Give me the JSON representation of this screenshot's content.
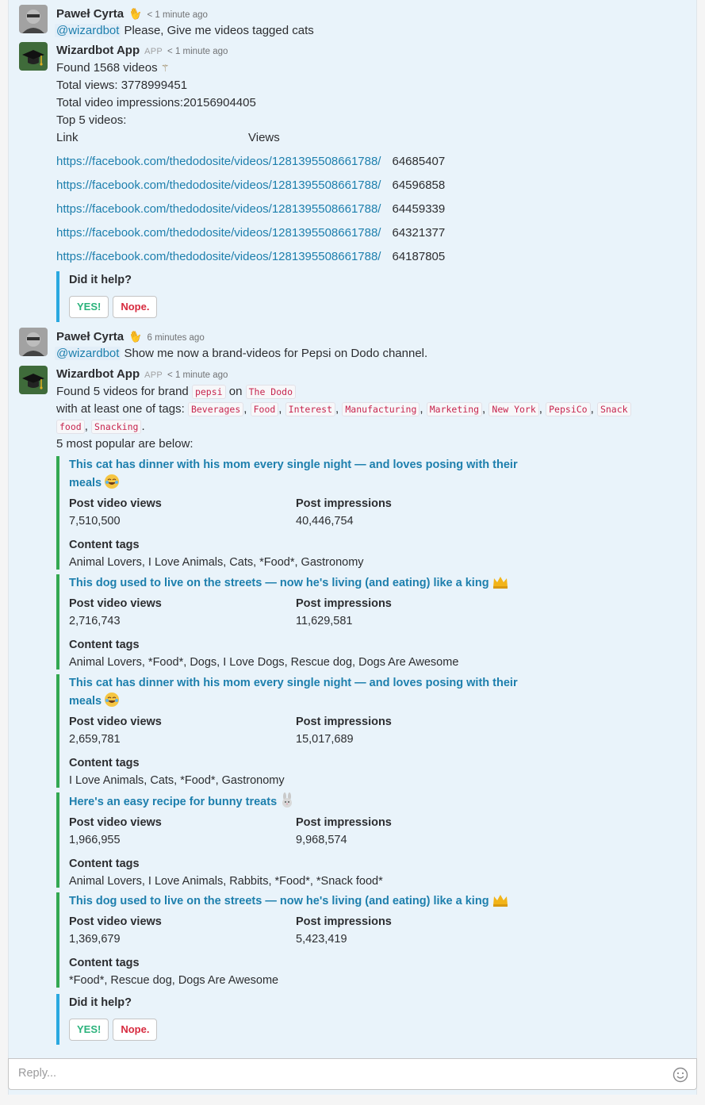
{
  "messages": [
    {
      "author": "Paweł Cyrta",
      "timestamp": "< 1 minute ago",
      "mention": "@wizardbot",
      "text": "Please, Give me videos tagged cats"
    },
    {
      "author": "Wizardbot App",
      "badge": "APP",
      "timestamp": "< 1 minute ago",
      "found": "Found 1568 videos",
      "total_views": "Total views: 3778999451",
      "total_impressions": "Total video impressions:20156904405",
      "top5": "Top 5 videos:",
      "table_headers": [
        "Link",
        "Views"
      ],
      "rows": [
        {
          "link": "https://facebook.com/thedodosite/videos/1281395508661788/",
          "views": "64685407"
        },
        {
          "link": "https://facebook.com/thedodosite/videos/1281395508661788/",
          "views": "64596858"
        },
        {
          "link": "https://facebook.com/thedodosite/videos/1281395508661788/",
          "views": "64459339"
        },
        {
          "link": "https://facebook.com/thedodosite/videos/1281395508661788/",
          "views": "64321377"
        },
        {
          "link": "https://facebook.com/thedodosite/videos/1281395508661788/",
          "views": "64187805"
        }
      ],
      "feedback": {
        "question": "Did it help?",
        "yes": "YES!",
        "no": "Nope."
      }
    },
    {
      "author": "Paweł Cyrta",
      "timestamp": "6 minutes ago",
      "mention": "@wizardbot",
      "text": "Show me now a brand-videos for Pepsi on Dodo channel."
    },
    {
      "author": "Wizardbot App",
      "badge": "APP",
      "timestamp": "< 1 minute ago",
      "found_prefix": "Found 5 videos for brand",
      "brand": "pepsi",
      "on": "on",
      "channel": "The Dodo",
      "tags_prefix": "with at least one of tags:",
      "tags": [
        "Beverages",
        "Food",
        "Interest",
        "Manufacturing",
        "Marketing",
        "New York",
        "PepsiCo",
        "Snack",
        "food",
        "Snacking"
      ],
      "popular": "5 most popular are below:",
      "label_views": "Post video views",
      "label_impressions": "Post impressions",
      "label_tags": "Content tags",
      "videos": [
        {
          "title_1": "This cat has dinner with his mom every single night — and loves posing with their",
          "title_2": "meals",
          "emoji": "joy-emoji",
          "views": "7,510,500",
          "impressions": "40,446,754",
          "tags": "Animal Lovers, I Love Animals, Cats, *Food*, Gastronomy"
        },
        {
          "title_1": "This dog used to live on the streets — now he's living (and eating) like a king",
          "title_2": "",
          "emoji": "crown-emoji",
          "views": "2,716,743",
          "impressions": "11,629,581",
          "tags": "Animal Lovers, *Food*, Dogs, I Love Dogs, Rescue dog, Dogs Are Awesome"
        },
        {
          "title_1": "This cat has dinner with his mom every single night — and loves posing with their",
          "title_2": "meals",
          "emoji": "joy-emoji",
          "views": "2,659,781",
          "impressions": "15,017,689",
          "tags": "I Love Animals, Cats, *Food*, Gastronomy"
        },
        {
          "title_1": "Here's an easy recipe for bunny treats",
          "title_2": "",
          "emoji": "rabbit-emoji",
          "views": "1,966,955",
          "impressions": "9,968,574",
          "tags": "Animal Lovers, I Love Animals, Rabbits, *Food*, *Snack food*"
        },
        {
          "title_1": "This dog used to live on the streets — now he's living (and eating) like a king",
          "title_2": "",
          "emoji": "crown-emoji",
          "views": "1,369,679",
          "impressions": "5,423,419",
          "tags": "*Food*, Rescue dog, Dogs Are Awesome"
        }
      ],
      "feedback": {
        "question": "Did it help?",
        "yes": "YES!",
        "no": "Nope."
      }
    }
  ],
  "composer": {
    "placeholder": "Reply...",
    "emoji_button": "smiley-icon"
  },
  "colors": {
    "link": "#1d7fad",
    "attachment_green": "#33a852",
    "attachment_blue": "#2aa8e0",
    "yes": "#2ab27b",
    "no": "#d72b3f",
    "code": "#c7254e"
  }
}
